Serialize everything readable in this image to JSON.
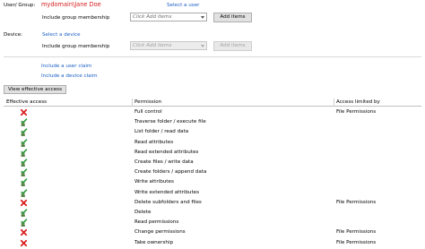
{
  "user_group": {
    "label": "User/ Group:",
    "value": "mydomain\\Jane Doe",
    "select_link": "Select a user",
    "include_membership_label": "Include group membership",
    "combo_placeholder": "Click Add items",
    "add_items": "Add items"
  },
  "device": {
    "label": "Device:",
    "select_link": "Select a device",
    "include_membership_label": "Include group membership",
    "combo_placeholder": "Click Add items",
    "add_items": "Add items"
  },
  "claims": {
    "include_user_claim": "Include a user claim",
    "include_device_claim": "Include a device claim"
  },
  "view_button": "View effective access",
  "table": {
    "headers": [
      "Effective access",
      "Permission",
      "Access limited by"
    ],
    "rows": [
      {
        "access": "deny",
        "permission": "Full control",
        "limited_by": "File Permissions"
      },
      {
        "access": "allow",
        "permission": "Traverse folder / execute file",
        "limited_by": ""
      },
      {
        "access": "allow",
        "permission": "List folder / read data",
        "limited_by": ""
      },
      {
        "access": "allow",
        "permission": "Read attributes",
        "limited_by": ""
      },
      {
        "access": "allow",
        "permission": "Read extended attributes",
        "limited_by": ""
      },
      {
        "access": "allow",
        "permission": "Create files / write data",
        "limited_by": ""
      },
      {
        "access": "allow",
        "permission": "Create folders / append data",
        "limited_by": ""
      },
      {
        "access": "allow",
        "permission": "Write attributes",
        "limited_by": ""
      },
      {
        "access": "allow",
        "permission": "Write extended attributes",
        "limited_by": ""
      },
      {
        "access": "deny",
        "permission": "Delete subfolders and files",
        "limited_by": "File Permissions"
      },
      {
        "access": "allow",
        "permission": "Delete",
        "limited_by": ""
      },
      {
        "access": "allow",
        "permission": "Read permissions",
        "limited_by": ""
      },
      {
        "access": "deny",
        "permission": "Change permissions",
        "limited_by": "File Permissions"
      },
      {
        "access": "deny",
        "permission": "Take ownership",
        "limited_by": "File Permissions"
      }
    ]
  },
  "colors": {
    "allow": "#2e9a3e",
    "deny": "#d92020",
    "link": "#1a5fc4"
  },
  "icons": {
    "allow": "checkmark-user-icon",
    "deny": "red-x-icon"
  }
}
